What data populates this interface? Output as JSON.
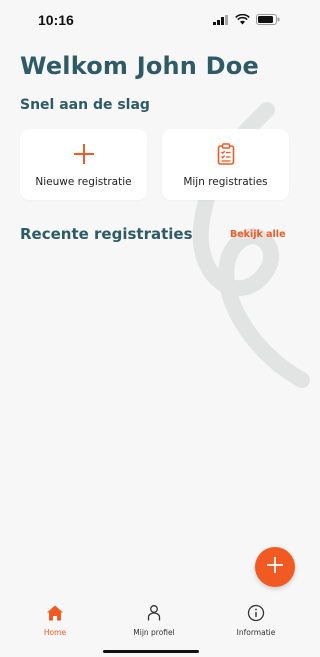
{
  "status_bar": {
    "time": "10:16",
    "icons": [
      "signal-icon",
      "wifi-icon",
      "battery-icon"
    ]
  },
  "header": {
    "welcome": "Welkom John Doe"
  },
  "quick_start": {
    "title": "Snel aan de slag",
    "cards": [
      {
        "label": "Nieuwe registratie",
        "icon": "plus-icon"
      },
      {
        "label": "Mijn registraties",
        "icon": "clipboard-icon"
      }
    ]
  },
  "recent": {
    "title": "Recente registraties",
    "see_all": "Bekijk alle"
  },
  "fab": {
    "icon": "plus-icon"
  },
  "tabbar": {
    "items": [
      {
        "label": "Home",
        "icon": "home-icon",
        "active": true
      },
      {
        "label": "Mijn profiel",
        "icon": "person-icon",
        "active": false
      },
      {
        "label": "Informatie",
        "icon": "info-icon",
        "active": false
      }
    ]
  },
  "colors": {
    "accent": "#f15a22",
    "heading": "#2f5b66",
    "background": "#f7f7f7"
  }
}
